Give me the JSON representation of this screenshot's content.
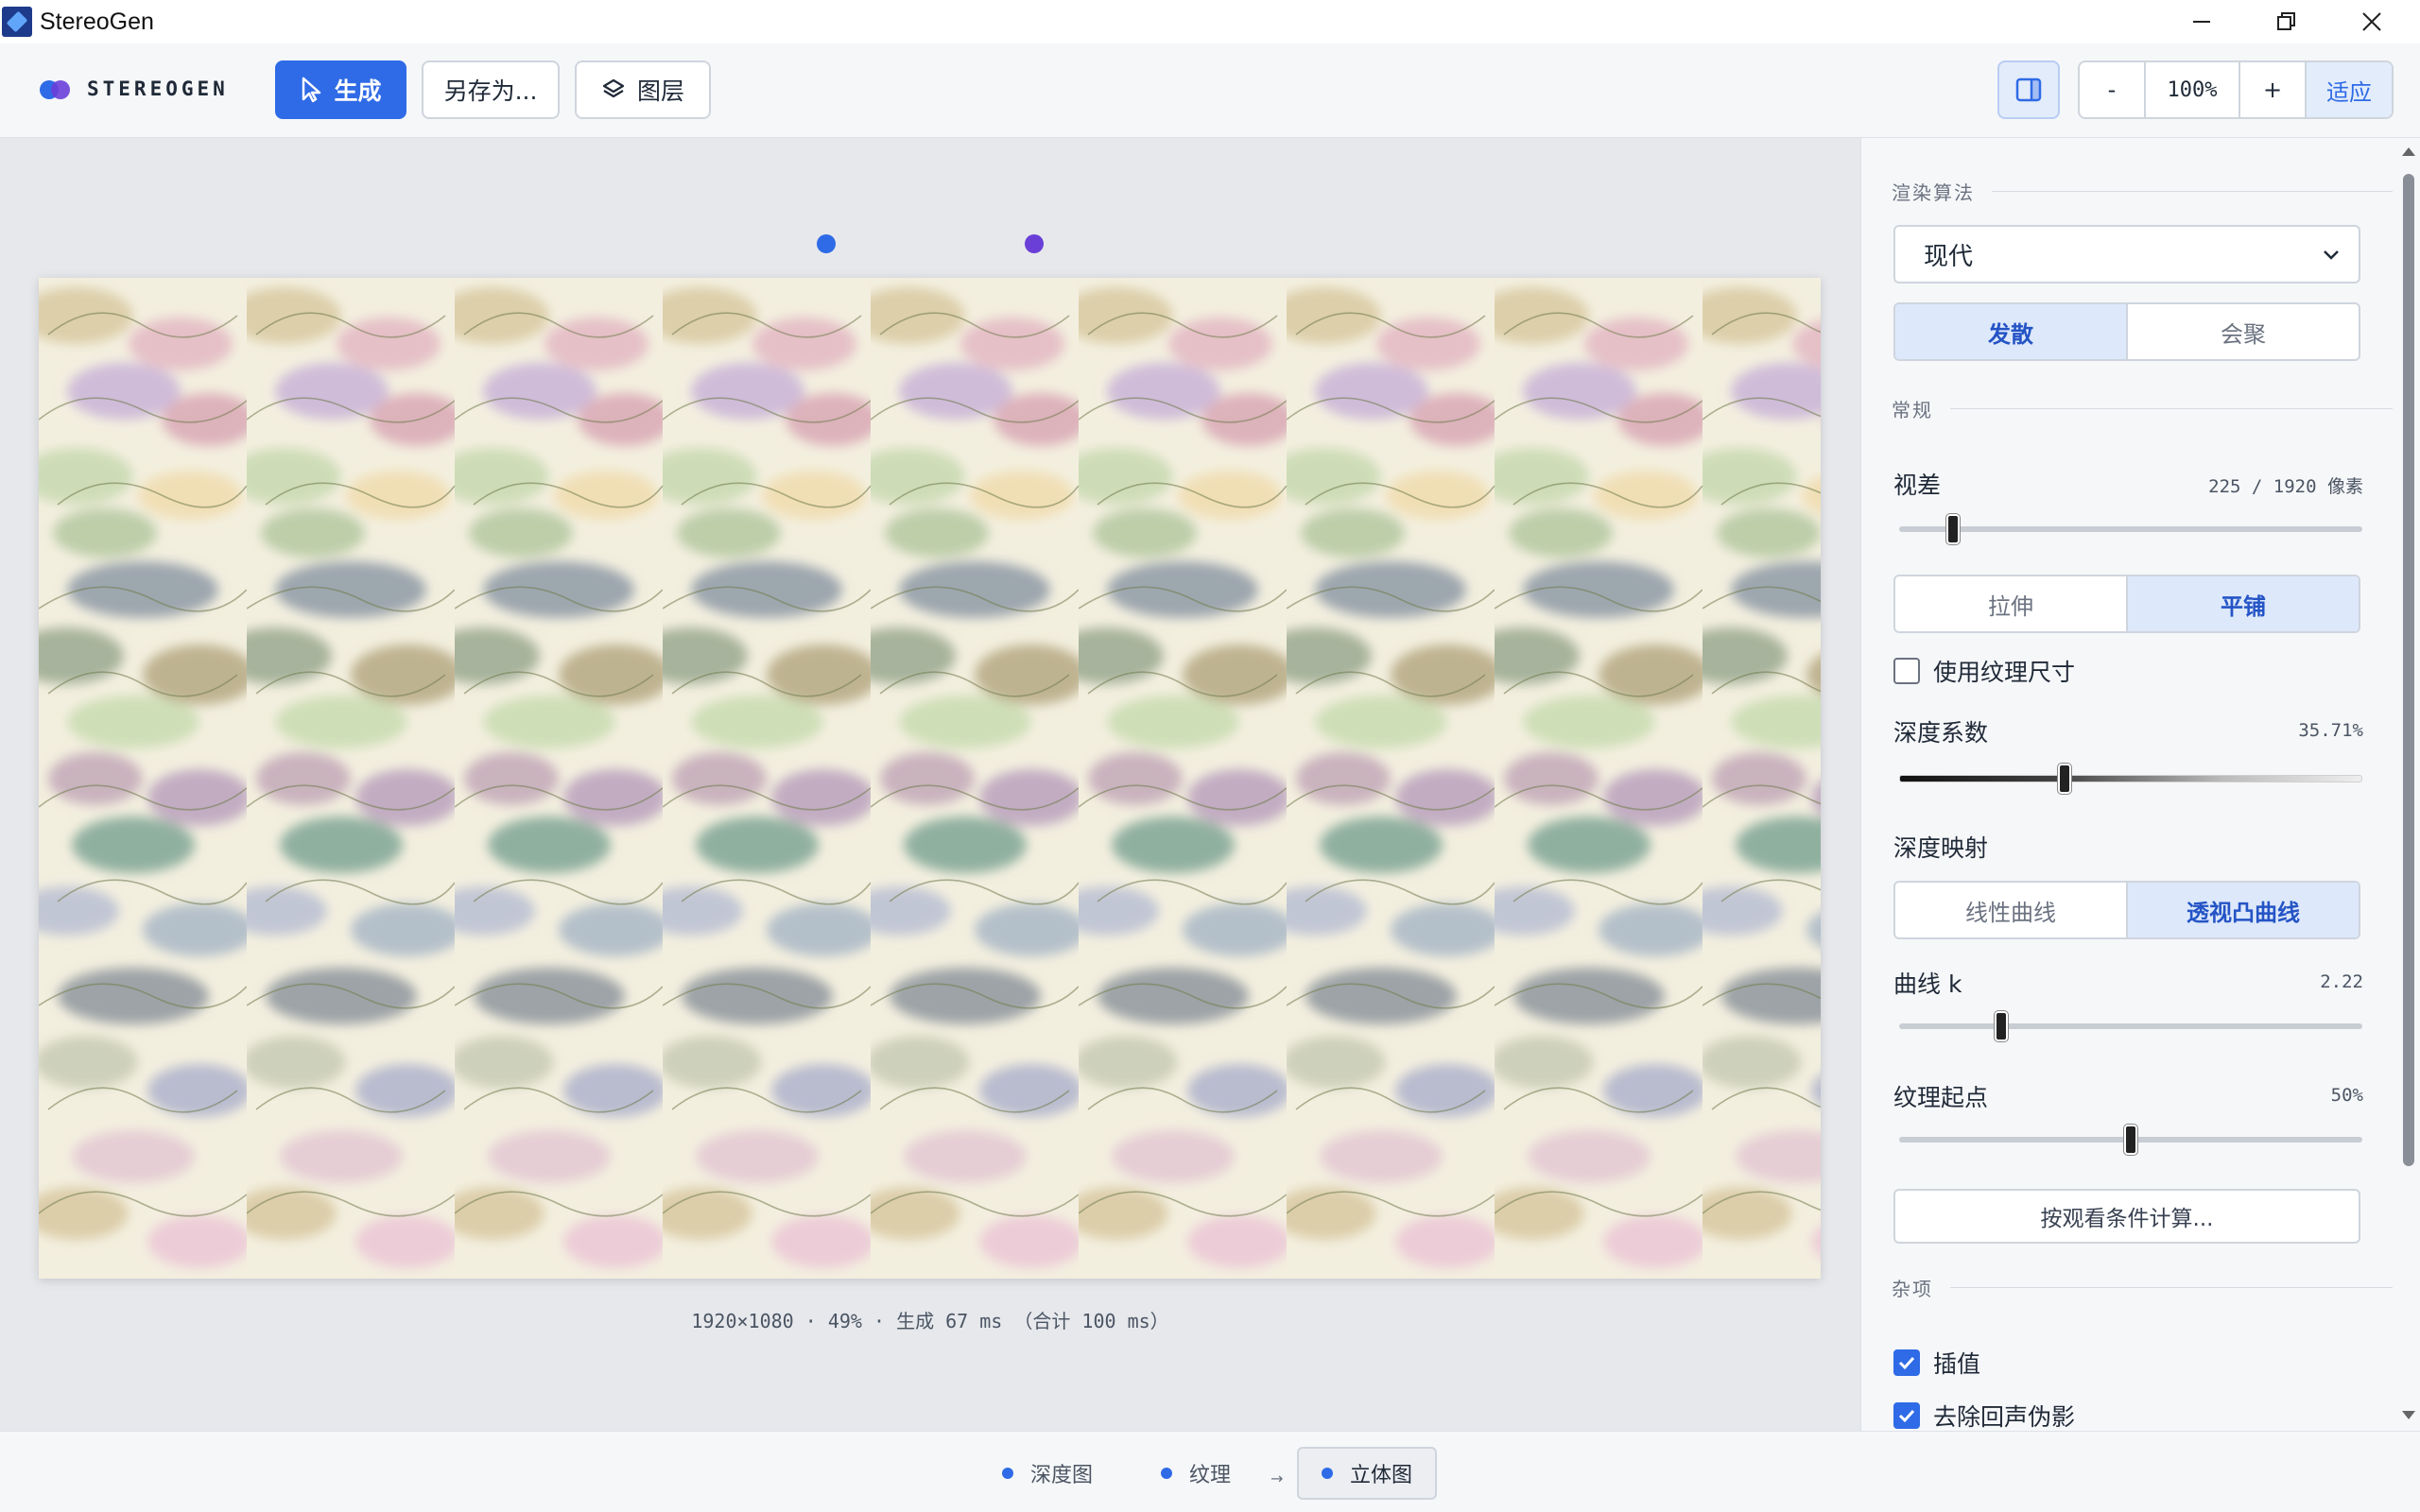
{
  "window": {
    "title": "StereoGen"
  },
  "toolbar": {
    "brand": "STEREOGEN",
    "generate_label": "生成",
    "save_as_label": "另存为...",
    "layers_label": "图层",
    "zoom_out_label": "-",
    "zoom_level": "100%",
    "zoom_in_label": "+",
    "fit_label": "适应"
  },
  "canvas": {
    "info": "1920×1080 · 49% · 生成 67 ms （合计 100 ms）",
    "eye_dot_colors": [
      "#2f6be6",
      "#6a3fd8"
    ]
  },
  "panel": {
    "render_section": "渲染算法",
    "algorithm_selected": "现代",
    "mode_options": [
      "发散",
      "会聚"
    ],
    "mode_active": 0,
    "general_section": "常规",
    "parallax_label": "视差",
    "parallax_value": "225 / 1920 像素",
    "parallax_fraction": 0.117,
    "fill_options": [
      "拉伸",
      "平铺"
    ],
    "fill_active": 1,
    "use_texture_size_label": "使用纹理尺寸",
    "use_texture_size_checked": false,
    "depth_factor_label": "深度系数",
    "depth_factor_value": "35.71%",
    "depth_factor_fraction": 0.3571,
    "depth_mapping_label": "深度映射",
    "mapping_options": [
      "线性曲线",
      "透视凸曲线"
    ],
    "mapping_active": 1,
    "curve_k_label": "曲线 k",
    "curve_k_value": "2.22",
    "curve_k_fraction": 0.22,
    "texture_origin_label": "纹理起点",
    "texture_origin_value": "50%",
    "texture_origin_fraction": 0.5,
    "calc_button_label": "按观看条件计算...",
    "misc_section": "杂项",
    "interpolate_label": "插值",
    "interpolate_checked": true,
    "remove_echo_label": "去除回声伪影",
    "remove_echo_checked": true
  },
  "bottom": {
    "depth_map_label": "深度图",
    "texture_label": "纹理",
    "arrow": "→",
    "stereogram_label": "立体图"
  },
  "colors": {
    "accent": "#2f6be6",
    "accent_purple": "#6a3fd8"
  }
}
